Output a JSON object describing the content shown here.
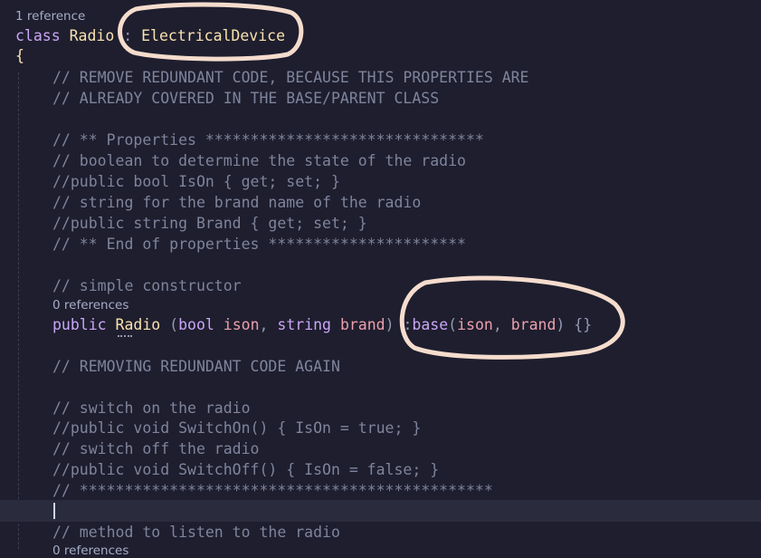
{
  "codelens": {
    "class_refs": "1 reference",
    "ctor_refs": "0 references",
    "method_refs": "0 references"
  },
  "lines": {
    "class_kw": "class",
    "class_name": "Radio",
    "class_colon": " : ",
    "base_class": "ElectricalDevice",
    "open_brace": "{",
    "c1": "// REMOVE REDUNDANT CODE, BECAUSE THIS PROPERTIES ARE",
    "c2": "// ALREADY COVERED IN THE BASE/PARENT CLASS",
    "c3": "// ** Properties *******************************",
    "c4": "// boolean to determine the state of the radio",
    "c5": "//public bool IsOn { get; set; }",
    "c6": "// string for the brand name of the radio",
    "c7": "//public string Brand { get; set; }",
    "c8": "// ** End of properties **********************",
    "c9": "// simple constructor",
    "ctor_public": "public ",
    "ctor_name": "Radio",
    "ctor_open": " (",
    "ctor_bool": "bool ",
    "ctor_ison": "ison",
    "ctor_comma": ", ",
    "ctor_string": "string ",
    "ctor_brand": "brand",
    "ctor_close": ") :",
    "ctor_base": "base",
    "ctor_bopen": "(",
    "ctor_ison2": "ison",
    "ctor_comma2": ", ",
    "ctor_brand2": "brand",
    "ctor_bclose": ") {}",
    "c10": "// REMOVING REDUNDANT CODE AGAIN",
    "c11": "// switch on the radio",
    "c12": "//public void SwitchOn() { IsOn = true; }",
    "c13": "// switch off the radio",
    "c14": "//public void SwitchOff() { IsOn = false; }",
    "c15": "// **********************************************",
    "c16": "// method to listen to the radio"
  },
  "colors": {
    "background": "#1e1e2e",
    "keyword": "#cba6f7",
    "type": "#f9e2af",
    "parameter": "#eba0ac",
    "comment": "#7f849c",
    "annotation": "#f5dccd"
  }
}
